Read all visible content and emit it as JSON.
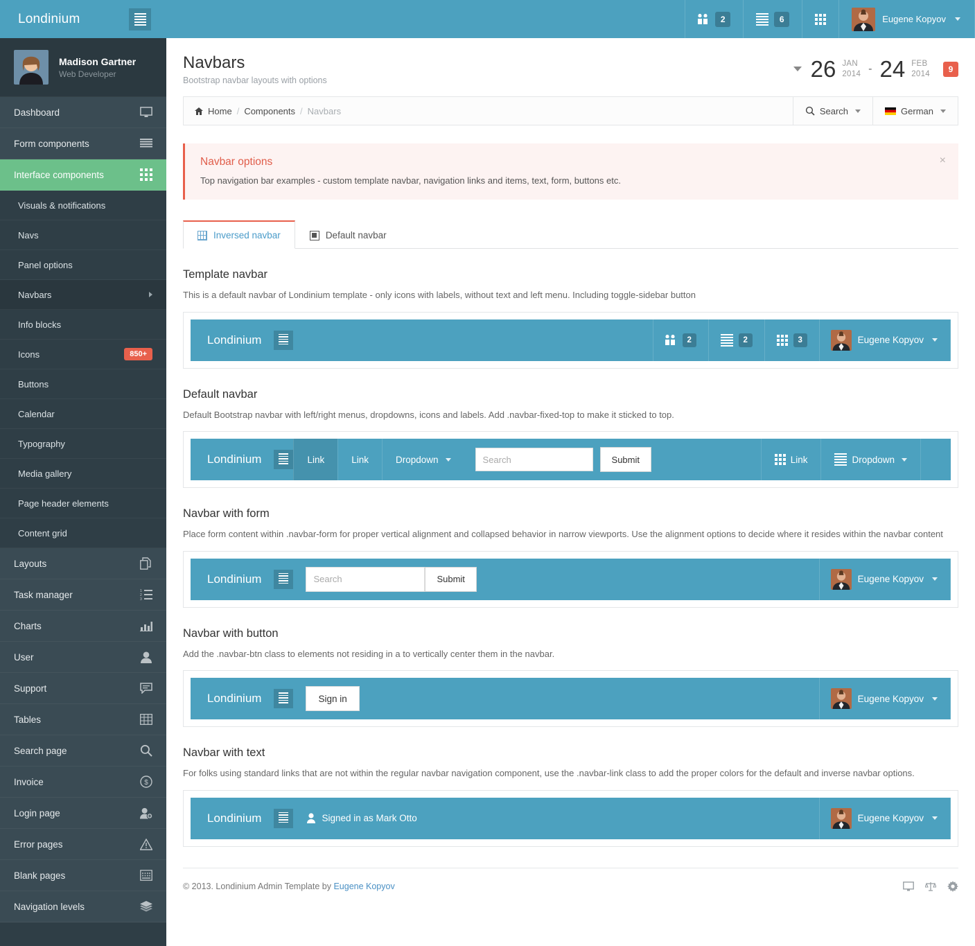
{
  "header": {
    "brand": "Londinium",
    "toggle_icon": "hamburger-icon",
    "nav": [
      {
        "icon": "users-icon",
        "badge": "2"
      },
      {
        "icon": "list-lines-icon",
        "badge": "6"
      },
      {
        "icon": "grid-dots-icon",
        "badge": ""
      }
    ],
    "user_name": "Eugene Kopyov"
  },
  "sidebar": {
    "profile": {
      "name": "Madison Gartner",
      "role": "Web Developer"
    },
    "items": [
      {
        "label": "Dashboard",
        "icon": "monitor-icon",
        "type": "top"
      },
      {
        "label": "Form components",
        "icon": "lines-icon",
        "type": "top"
      },
      {
        "label": "Interface components",
        "icon": "grid-icon",
        "type": "active"
      },
      {
        "label": "Visuals & notifications",
        "type": "sub"
      },
      {
        "label": "Navs",
        "type": "sub"
      },
      {
        "label": "Panel options",
        "type": "sub"
      },
      {
        "label": "Navbars",
        "type": "sub-current",
        "chevron": true
      },
      {
        "label": "Info blocks",
        "type": "sub"
      },
      {
        "label": "Icons",
        "type": "sub",
        "badge": "850+"
      },
      {
        "label": "Buttons",
        "type": "sub"
      },
      {
        "label": "Calendar",
        "type": "sub"
      },
      {
        "label": "Typography",
        "type": "sub"
      },
      {
        "label": "Media gallery",
        "type": "sub"
      },
      {
        "label": "Page header elements",
        "type": "sub"
      },
      {
        "label": "Content grid",
        "type": "sub"
      },
      {
        "label": "Layouts",
        "icon": "copy-icon",
        "type": "top"
      },
      {
        "label": "Task manager",
        "icon": "ordered-list-icon",
        "type": "top"
      },
      {
        "label": "Charts",
        "icon": "bar-chart-icon",
        "type": "top"
      },
      {
        "label": "User",
        "icon": "person-icon",
        "type": "top"
      },
      {
        "label": "Support",
        "icon": "comment-icon",
        "type": "top"
      },
      {
        "label": "Tables",
        "icon": "table-icon",
        "type": "top"
      },
      {
        "label": "Search page",
        "icon": "search-icon",
        "type": "top"
      },
      {
        "label": "Invoice",
        "icon": "dollar-circle-icon",
        "type": "top"
      },
      {
        "label": "Login page",
        "icon": "user-add-icon",
        "type": "top"
      },
      {
        "label": "Error pages",
        "icon": "warning-triangle-icon",
        "type": "top"
      },
      {
        "label": "Blank pages",
        "icon": "blank-page-icon",
        "type": "top"
      },
      {
        "label": "Navigation levels",
        "icon": "layers-icon",
        "type": "top"
      }
    ]
  },
  "page": {
    "title": "Navbars",
    "subtitle": "Bootstrap navbar layouts with options",
    "daterange": {
      "start_day": "26",
      "start_month": "JAN",
      "start_year": "2014",
      "dash": "-",
      "end_day": "24",
      "end_month": "FEB",
      "end_year": "2014",
      "badge": "9"
    }
  },
  "breadcrumb": {
    "home": "Home",
    "sep1": "/",
    "components": "Components",
    "sep2": "/",
    "current": "Navbars",
    "search_label": "Search",
    "language_label": "German"
  },
  "alert": {
    "title": "Navbar options",
    "text": "Top navigation bar examples - custom template navbar, navigation links and items, text, form, buttons etc.",
    "close": "×"
  },
  "tabs": [
    {
      "label": "Inversed navbar",
      "icon": "grid-table-icon",
      "active": true
    },
    {
      "label": "Default navbar",
      "icon": "filled-square-icon",
      "active": false
    }
  ],
  "sections": {
    "template_navbar": {
      "title": "Template navbar",
      "desc": "This is a default navbar of Londinium template - only icons with labels, without text and left menu. Including toggle-sidebar button",
      "brand": "Londinium",
      "cells": [
        {
          "icon": "users-icon",
          "badge": "2"
        },
        {
          "icon": "list-lines-icon",
          "badge": "2"
        },
        {
          "icon": "grid-dots-icon",
          "badge": "3"
        }
      ],
      "user_name": "Eugene Kopyov"
    },
    "default_navbar": {
      "title": "Default navbar",
      "desc": "Default Bootstrap navbar with left/right menus, dropdowns, icons and labels. Add .navbar-fixed-top to make it sticked to top.",
      "brand": "Londinium",
      "link1": "Link",
      "link2": "Link",
      "dropdown1": "Dropdown",
      "search_placeholder": "Search",
      "submit": "Submit",
      "right_link": "Link",
      "right_dropdown": "Dropdown"
    },
    "navbar_form": {
      "title": "Navbar with form",
      "desc": "Place form content within .navbar-form for proper vertical alignment and collapsed behavior in narrow viewports. Use the alignment options to decide where it resides within the navbar content",
      "brand": "Londinium",
      "search_placeholder": "Search",
      "submit": "Submit",
      "user_name": "Eugene Kopyov"
    },
    "navbar_button": {
      "title": "Navbar with button",
      "desc": "Add the .navbar-btn class to elements not residing in a to vertically center them in the navbar.",
      "brand": "Londinium",
      "sign_in": "Sign in",
      "user_name": "Eugene Kopyov"
    },
    "navbar_text": {
      "title": "Navbar with text",
      "desc": "For folks using standard links that are not within the regular navbar navigation component, use the .navbar-link class to add the proper colors for the default and inverse navbar options.",
      "brand": "Londinium",
      "signed_in_text": "Signed in as Mark Otto",
      "user_name": "Eugene Kopyov"
    }
  },
  "footer": {
    "copyright": "© 2013. Londinium Admin Template by ",
    "author": "Eugene Kopyov",
    "icons": [
      "monitor-icon",
      "scales-icon",
      "gear-icon"
    ]
  },
  "colors": {
    "brand_blue": "#4CA1BF",
    "sidebar_dark": "#2F3E46",
    "sidebar_item": "#3A4B54",
    "accent_green": "#6CC08A",
    "accent_red": "#E8604C",
    "link_blue": "#4A90C4"
  }
}
